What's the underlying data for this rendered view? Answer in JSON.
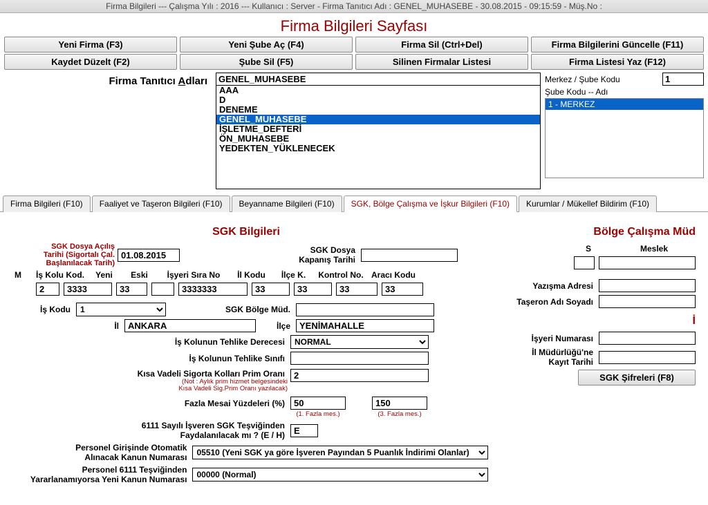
{
  "titlebar": "Firma Bilgileri  ---  Çalışma Yılı : 2016  ---  Kullanıcı : Server - Firma Tanıtıcı Adı : GENEL_MUHASEBE - 30.08.2015 - 09:15:59 - Müş.No :",
  "page_title": "Firma Bilgileri Sayfası",
  "buttons_row1": {
    "b1": "Yeni Firma (F3)",
    "b2": "Yeni Şube Aç (F4)",
    "b3": "Firma Sil (Ctrl+Del)",
    "b4": "Firma Bilgilerini Güncelle (F11)"
  },
  "buttons_row2": {
    "b1": "Kaydet Düzelt (F2)",
    "b2": "Şube Sil (F5)",
    "b3": "Silinen Firmalar Listesi",
    "b4": "Firma Listesi Yaz (F12)"
  },
  "firm_label_pre": "Firma Tanıtıcı ",
  "firm_label_u": "A",
  "firm_label_post": "dları",
  "firm_value": "GENEL_MUHASEBE",
  "firm_list": [
    "AAA",
    "D",
    "DENEME",
    "GENEL_MUHASEBE",
    "İŞLETME_DEFTERİ",
    "ÖN_MUHASEBE",
    "YEDEKTEN_YÜKLENECEK"
  ],
  "firm_selected_index": 3,
  "right": {
    "merkez_sube_kodu_lbl": "Merkez / Şube Kodu",
    "merkez_sube_kodu_val": "1",
    "sube_kodu_adi_lbl": "Şube Kodu -- Adı",
    "sube_sel": "1 - MERKEZ"
  },
  "tabs": [
    "Firma Bilgileri (F10)",
    "Faaliyet ve Taşeron Bilgileri (F10)",
    "Beyanname Bilgileri (F10)",
    "SGK, Bölge Çalışma ve İşkur Bilgileri (F10)",
    "Kurumlar / Mükellef Bildirim (F10)"
  ],
  "tab_active_index": 3,
  "sgk": {
    "title": "SGK Bilgileri",
    "acilis_lbl_1": "SGK Dosya Açılış",
    "acilis_lbl_2": "Tarihi (Sigortalı Çal.",
    "acilis_lbl_3": "Başlanılacak Tarih)",
    "acilis_val": "01.08.2015",
    "kapanis_lbl_1": "SGK Dosya",
    "kapanis_lbl_2": "Kapanış Tarihi",
    "kapanis_val": "",
    "hdr": {
      "m": "M",
      "iskolu": "İş Kolu Kod.",
      "yeni": "Yeni",
      "eski": "Eski",
      "sira": "İşyeri Sıra No",
      "il": "İl Kodu",
      "ilce": "İlçe K.",
      "kontrol": "Kontrol No.",
      "araci": "Aracı Kodu"
    },
    "val": {
      "m": "2",
      "iskolu": "3333",
      "yeni": "33",
      "eski": "",
      "sira": "3333333",
      "il": "33",
      "ilce": "33",
      "kontrol": "33",
      "araci": "33"
    },
    "is_kodu_lbl": "İş Kodu",
    "is_kodu_val": "1",
    "bolge_mud_lbl": "SGK Bölge Müd.",
    "bolge_mud_val": "",
    "il_lbl": "İl",
    "il_val": "ANKARA",
    "ilcen_lbl": "İlçe",
    "ilce_val": "YENİMAHALLE",
    "tehlike_derece_lbl": "İş Kolunun Tehlike Derecesi",
    "tehlike_derece_val": "NORMAL",
    "tehlike_sinif_lbl": "İş Kolunun Tehlike Sınıfı",
    "tehlike_sinif_val": "",
    "kisa_vadeli_lbl": "Kısa Vadeli Sigorta Kolları Prim Oranı",
    "kisa_vadeli_note1": "(Not : Aylık prim hizmet belgesindeki",
    "kisa_vadeli_note2": "Kısa Vadeli Sig.Prim Oranı yazılacak)",
    "kisa_vadeli_val": "2",
    "fazla_mesai_lbl": "Fazla Mesai Yüzdeleri (%)",
    "fazla1": "50",
    "fazla2": "150",
    "fazla1_note": "(1. Fazla mes.)",
    "fazla2_note": "(3. Fazla mes.)",
    "tesvik_lbl1": "6111 Sayılı İşveren SGK Teşviğinden",
    "tesvik_lbl2": "Faydalanılacak mı ? (E / H)",
    "tesvik_val": "E",
    "oto_kanun_lbl1": "Personel Girişinde Otomatik",
    "oto_kanun_lbl2": "Alınacak Kanun Numarası",
    "oto_kanun_val": "05510 (Yeni SGK ya göre İşveren Payından 5 Puanlık İndirimi Olanlar)",
    "yeni_kanun_lbl1": "Personel 6111 Teşviğinden",
    "yeni_kanun_lbl2": "Yararlanamıyorsa Yeni Kanun Numarası",
    "yeni_kanun_val": "00000 (Normal)"
  },
  "bolge": {
    "title": "Bölge Çalışma Müd",
    "s_hdr": "S",
    "meslek_hdr": "Meslek",
    "s_val": "",
    "meslek_val": "",
    "yazisma_lbl": "Yazışma Adresi",
    "yazisma_val": "",
    "taseron_lbl": "Taşeron Adı Soyadı",
    "taseron_val": "",
    "iskur_title": "İ",
    "isyeri_no_lbl": "İşyeri Numarası",
    "isyeri_no_val": "",
    "il_mud_lbl1": "İl Müdürlüğü'ne",
    "il_mud_lbl2": "Kayıt Tarihi",
    "il_mud_val": "",
    "sgk_sifre_btn": "SGK Şifreleri (F8)"
  }
}
